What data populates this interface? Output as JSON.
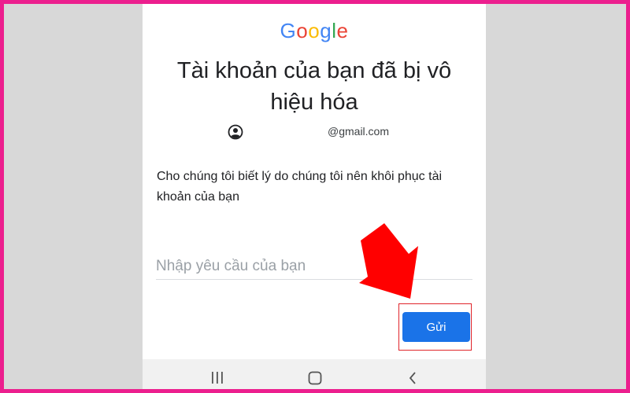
{
  "logo": {
    "letters": [
      "G",
      "o",
      "o",
      "g",
      "l",
      "e"
    ],
    "colors": [
      "#4285F4",
      "#EA4335",
      "#FBBC05",
      "#4285F4",
      "#34A853",
      "#EA4335"
    ]
  },
  "title": "Tài khoản của bạn đã bị vô hiệu hóa",
  "account": {
    "icon": "account-circle-icon",
    "email": "@gmail.com"
  },
  "prompt": "Cho chúng tôi biết lý do chúng tôi nên khôi phục tài khoản của bạn",
  "request_input": {
    "placeholder": "Nhập yêu cầu của bạn",
    "value": ""
  },
  "send_button": {
    "label": "Gửi",
    "color": "#1a73e8"
  },
  "annotation": {
    "arrow_color": "#ff0000",
    "highlight_color": "#e0252b"
  },
  "border_color": "#ec1f8e",
  "nav_bar": {
    "items": [
      "recent-apps-icon",
      "home-icon",
      "back-icon"
    ]
  }
}
